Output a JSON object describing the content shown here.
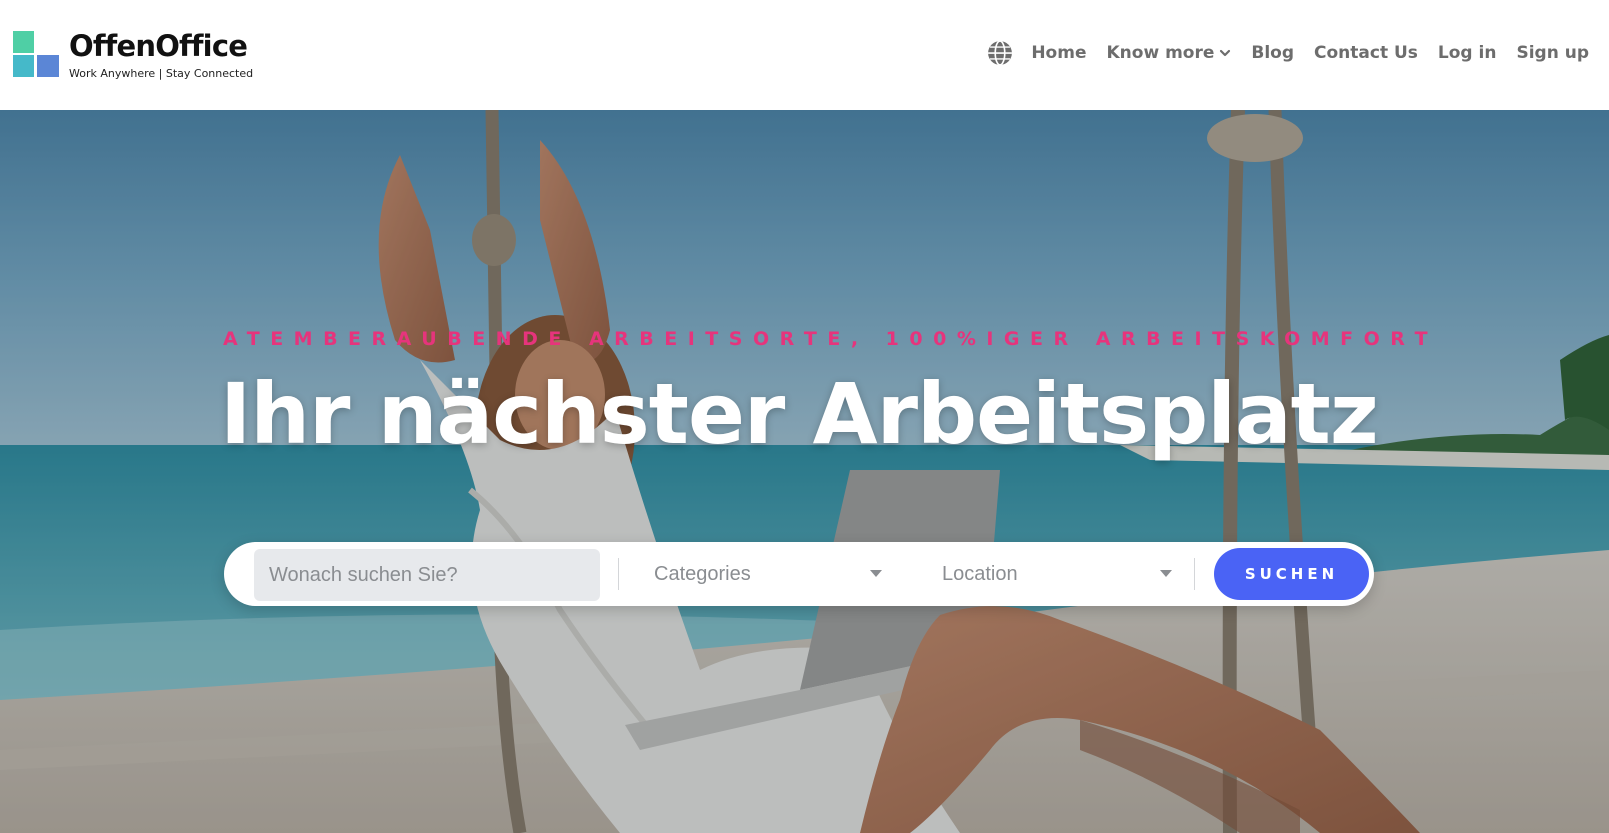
{
  "brand": {
    "name": "OffenOffice",
    "tagline": "Work Anywhere | Stay Connected",
    "colors": {
      "green": "#4fcfa5",
      "teal": "#45b9c9",
      "blue": "#5b86d6"
    }
  },
  "nav": {
    "language_icon": "globe-icon",
    "items": [
      {
        "label": "Home"
      },
      {
        "label": "Know more",
        "icon": "chevron-down-icon"
      },
      {
        "label": "Blog"
      },
      {
        "label": "Contact Us"
      },
      {
        "label": "Log in"
      },
      {
        "label": "Sign up"
      }
    ]
  },
  "hero": {
    "eyebrow": "ATEMBERAUBENDE ARBEITSORTE, 100%IGER ARBEITSKOMFORT",
    "title": "Ihr nächster Arbeitsplatz",
    "background": "beach swing with woman and laptop",
    "colors": {
      "eyebrow": "#e6347c",
      "button": "#4a63f5"
    }
  },
  "search": {
    "placeholder": "Wonach suchen Sie?",
    "value": "",
    "categories_label": "Categories",
    "location_label": "Location",
    "button_label": "SUCHEN"
  }
}
